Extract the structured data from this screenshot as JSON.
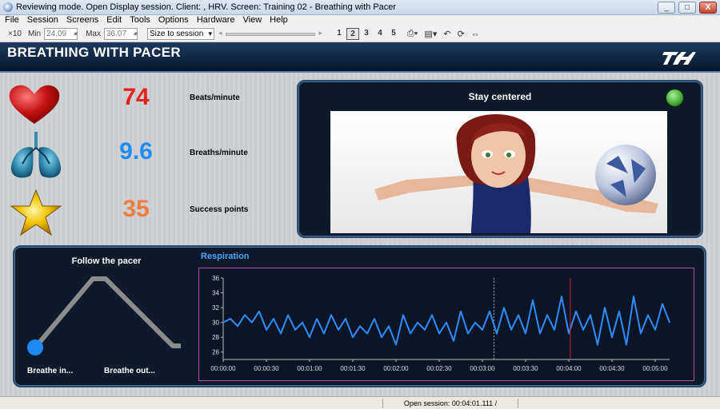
{
  "window": {
    "title": "Reviewing mode. Open Display session. Client: , HRV. Screen: Training 02 - Breathing with Pacer",
    "buttons": [
      "_",
      "□",
      "X"
    ]
  },
  "menu": [
    "File",
    "Session",
    "Screens",
    "Edit",
    "Tools",
    "Options",
    "Hardware",
    "View",
    "Help"
  ],
  "toolbar": {
    "zoom_label": "×10",
    "min_label": "Min",
    "min_value": "24.09",
    "max_label": "Max",
    "max_value": "36.07",
    "scale_mode": "Size to session",
    "pages": [
      "1",
      "2",
      "3",
      "4",
      "5"
    ],
    "active_page": "2"
  },
  "header": {
    "title": "BREATHING WITH PACER"
  },
  "metrics": [
    {
      "value": "74",
      "label": "Beats/minute",
      "color": "#e8231c",
      "icon": "heart-icon"
    },
    {
      "value": "9.6",
      "label": "Breaths/minute",
      "color": "#1e8cf0",
      "icon": "lungs-icon"
    },
    {
      "value": "35",
      "label": "Success points",
      "color": "#ef7b3c",
      "icon": "star-icon"
    }
  ],
  "video": {
    "title": "Stay centered",
    "indicator_color": "#3fa52f"
  },
  "pacer": {
    "title": "Follow the pacer",
    "inhale_label": "Breathe in...",
    "exhale_label": "Breathe out...",
    "phase_fraction": 0.0
  },
  "respiration": {
    "title": "Respiration"
  },
  "chart_data": {
    "type": "line",
    "title": "Respiration",
    "ylim": [
      25,
      36
    ],
    "yticks": [
      26,
      28,
      30,
      32,
      34,
      36
    ],
    "xticks": [
      "00:00:00",
      "00:00:30",
      "00:01:00",
      "00:01:30",
      "00:02:00",
      "00:02:30",
      "00:03:00",
      "00:03:30",
      "00:04:00",
      "00:04:30",
      "00:05:00"
    ],
    "xlim_seconds": [
      0,
      310
    ],
    "cursor_time_seconds": 241,
    "marker_time_seconds": 188,
    "series": [
      {
        "color": "#2f8cff",
        "x": [
          0,
          5,
          10,
          15,
          20,
          25,
          30,
          35,
          40,
          45,
          50,
          55,
          60,
          65,
          70,
          75,
          80,
          85,
          90,
          95,
          100,
          105,
          110,
          115,
          120,
          125,
          130,
          135,
          140,
          145,
          150,
          155,
          160,
          165,
          170,
          175,
          180,
          185,
          190,
          195,
          200,
          205,
          210,
          215,
          220,
          225,
          230,
          235,
          240,
          245,
          250,
          255,
          260,
          265,
          270,
          275,
          280,
          285,
          290,
          295,
          300,
          305,
          310
        ],
        "y": [
          30,
          30.5,
          29.5,
          31,
          30,
          31.5,
          29,
          30.5,
          28.5,
          31,
          29,
          30,
          28,
          30.5,
          28.5,
          31,
          29,
          30.5,
          28,
          29.5,
          28.5,
          30.5,
          28,
          29.5,
          27,
          31,
          28.5,
          30,
          29,
          31,
          28.5,
          30,
          27.5,
          31.5,
          28.5,
          30,
          29,
          31.5,
          28.5,
          32,
          29,
          31,
          28.5,
          33,
          28.5,
          31,
          29,
          33.5,
          28.5,
          31.5,
          29,
          31,
          27,
          32,
          28,
          31.5,
          27,
          33.5,
          28.5,
          31,
          29,
          32.5,
          30
        ]
      }
    ]
  }
}
